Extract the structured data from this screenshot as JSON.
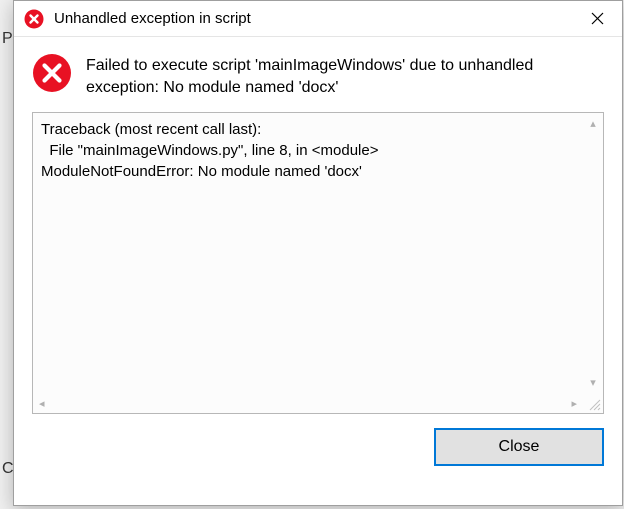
{
  "background": {
    "letter1": "P",
    "letter2": "C"
  },
  "titlebar": {
    "title": "Unhandled exception in script"
  },
  "message": "Failed to execute script 'mainImageWindows' due to unhandled exception: No module named 'docx'",
  "traceback": {
    "line1": "Traceback (most recent call last):",
    "line2": "  File \"mainImageWindows.py\", line 8, in <module>",
    "line3": "ModuleNotFoundError: No module named 'docx'"
  },
  "buttons": {
    "close": "Close"
  }
}
